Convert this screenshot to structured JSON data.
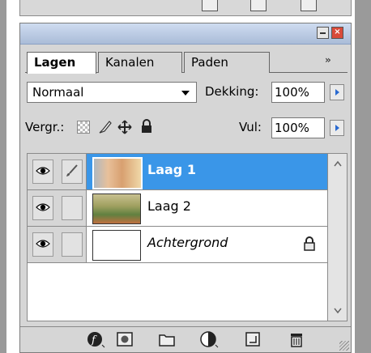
{
  "tabs": [
    {
      "label": "Lagen",
      "active": true
    },
    {
      "label": "Kanalen",
      "active": false
    },
    {
      "label": "Paden",
      "active": false
    }
  ],
  "tab_more": "»",
  "blend_mode": {
    "value": "Normaal"
  },
  "opacity": {
    "label": "Dekking:",
    "value": "100%"
  },
  "lock": {
    "label": "Vergr.:"
  },
  "fill": {
    "label": "Vul:",
    "value": "100%"
  },
  "layers": [
    {
      "name": "Laag 1",
      "visible": true,
      "selected": true,
      "locked": false
    },
    {
      "name": "Laag 2",
      "visible": true,
      "selected": false,
      "locked": false
    },
    {
      "name": "Achtergrond",
      "visible": true,
      "selected": false,
      "locked": true
    }
  ],
  "colors": {
    "selection": "#3a96e8",
    "panel": "#d6d6d6",
    "titlebar": "#aabcd8"
  },
  "icons": {
    "bottom_toolbar": [
      "link-icon",
      "layer-style-icon",
      "layer-mask-icon",
      "new-group-icon",
      "adjustment-layer-icon",
      "new-layer-icon",
      "trash-icon"
    ],
    "lock_options": [
      "lock-transparent-icon",
      "lock-image-icon",
      "lock-position-icon",
      "lock-all-icon"
    ]
  }
}
